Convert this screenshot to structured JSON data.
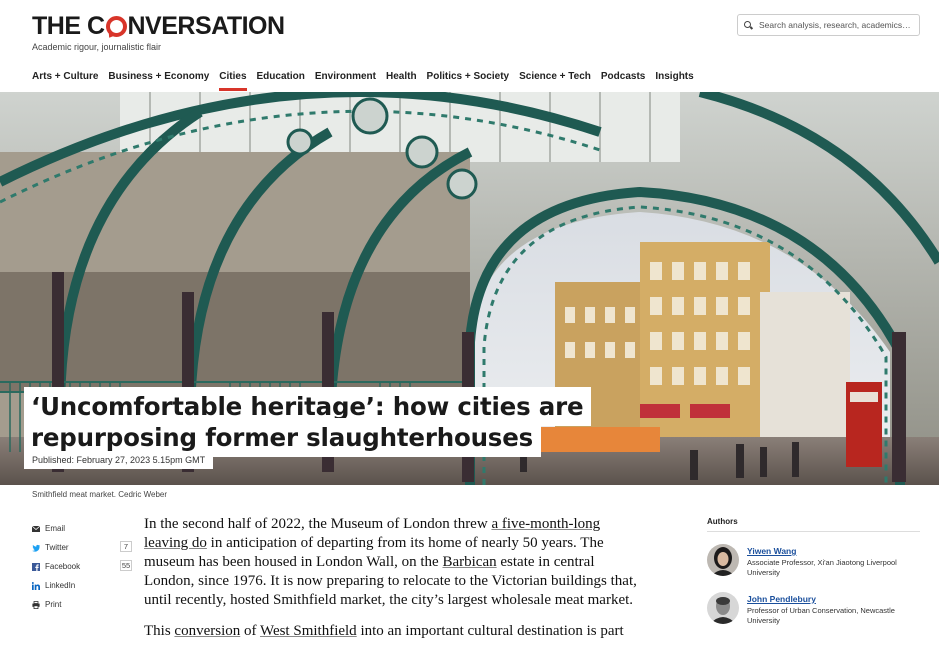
{
  "header": {
    "logo_text_before": "THE C",
    "logo_text_after": "NVERSATION",
    "tagline": "Academic rigour, journalistic flair",
    "search_placeholder": "Search analysis, research, academics…"
  },
  "nav": {
    "items": [
      "Arts + Culture",
      "Business + Economy",
      "Cities",
      "Education",
      "Environment",
      "Health",
      "Politics + Society",
      "Science + Tech",
      "Podcasts",
      "Insights"
    ],
    "active": "Cities"
  },
  "article": {
    "title_line1": "‘Uncomfortable heritage’: how cities are",
    "title_line2": "repurposing former slaughterhouses",
    "published": "Published: February 27, 2023 5.15pm GMT",
    "caption": "Smithfield meat market. Cedric Weber",
    "p1": {
      "t1": "In the second half of 2022, the Museum of London threw ",
      "link1": "a five-month-long leaving do",
      "t2": " in anticipation of departing from its home of nearly 50 years. The museum has been housed in London Wall, on the ",
      "link2": "Barbican",
      "t3": " estate in central London, since 1976. It is now preparing to relocate to the Victorian buildings that, until recently, hosted Smithfield market, the city’s largest wholesale meat market."
    },
    "p2": {
      "t1": "This ",
      "link1": "conversion",
      "t2": " of ",
      "link2": "West Smithfield",
      "t3": " into an important cultural destination is part"
    }
  },
  "share": {
    "email": "Email",
    "twitter": "Twitter",
    "twitter_count": "7",
    "facebook": "Facebook",
    "facebook_count": "55",
    "linkedin": "LinkedIn",
    "print": "Print"
  },
  "authors": {
    "heading": "Authors",
    "list": [
      {
        "name": "Yiwen Wang",
        "role": "Associate Professor, Xi'an Jiaotong Liverpool University"
      },
      {
        "name": "John Pendlebury",
        "role": "Professor of Urban Conservation, Newcastle University"
      }
    ]
  },
  "colors": {
    "accent": "#d8352a",
    "author_link": "#1a4f9c"
  }
}
